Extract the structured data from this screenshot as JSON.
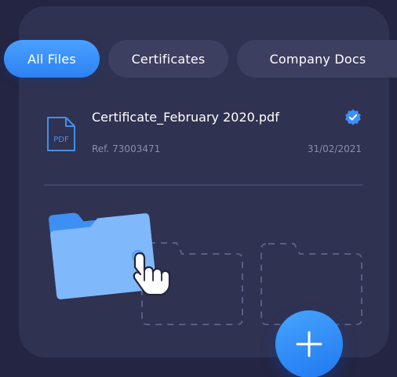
{
  "tabs": [
    {
      "label": "All Files",
      "active": true
    },
    {
      "label": "Certificates",
      "active": false
    },
    {
      "label": "Company Docs",
      "active": false
    }
  ],
  "file": {
    "icon_label": "PDF",
    "name": "Certificate_February 2020.pdf",
    "ref": "Ref. 73003471",
    "date": "31/02/2021",
    "verified": true
  },
  "icons": {
    "file_icon": "pdf-file-icon",
    "verified_icon": "verified-badge-icon",
    "folder_icon": "folder-icon",
    "hand_icon": "pointing-hand-icon",
    "add_icon": "plus-icon"
  },
  "colors": {
    "background": "#232542",
    "card": "#303251",
    "accent": "#2f86f6",
    "tab_inactive": "#3d3f60",
    "muted_text": "#8a8eae"
  }
}
